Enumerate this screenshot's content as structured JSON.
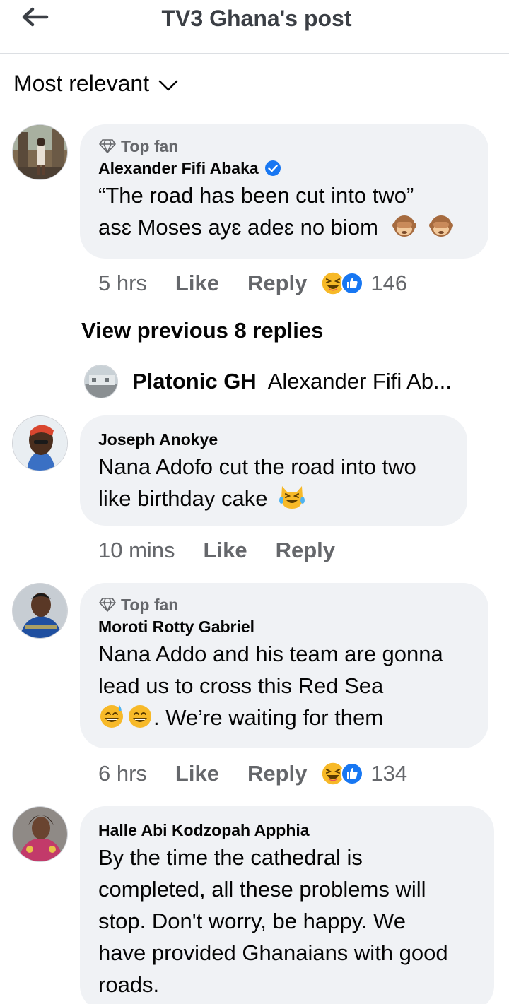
{
  "header": {
    "title": "TV3 Ghana's post"
  },
  "sort": {
    "label": "Most relevant"
  },
  "comments": [
    {
      "badge": "Top fan",
      "author": "Alexander Fifi Abaka",
      "verified": true,
      "text_line1": "“The road has been cut into two”",
      "text_line2": "asɛ Moses ayɛ adeɛ no biom",
      "time": "5 hrs",
      "like_label": "Like",
      "reply_label": "Reply",
      "reaction_count": "146",
      "reactions": [
        "laughing-emoji",
        "like-icon"
      ]
    },
    {
      "author": "Joseph Anokye",
      "text_line1": "Nana Adofo cut the road into two",
      "text_line2": "like birthday cake",
      "time": "10 mins",
      "like_label": "Like",
      "reply_label": "Reply"
    },
    {
      "badge": "Top fan",
      "author": "Moroti Rotty Gabriel",
      "text_line1": "Nana Addo and his team are gonna",
      "text_line2": "lead us to cross this Red Sea",
      "text_line3": ". We’re waiting for them",
      "time": "6 hrs",
      "like_label": "Like",
      "reply_label": "Reply",
      "reaction_count": "134",
      "reactions": [
        "laughing-emoji",
        "like-icon"
      ]
    },
    {
      "author": "Halle Abi Kodzopah Apphia",
      "text_line1": "By the time the cathedral is",
      "text_line2": "completed, all these problems will",
      "text_line3": "stop. Don't worry, be happy. We",
      "text_line4": "have provided Ghanaians with good",
      "text_line5": "roads."
    }
  ],
  "view_previous": {
    "label": "View previous 8 replies"
  },
  "reply_preview": {
    "name": "Platonic GH",
    "text": "Alexander Fifi Ab..."
  },
  "colors": {
    "verified": "#1877f2",
    "bubble": "#f0f2f5",
    "secondary_text": "#65676b"
  }
}
